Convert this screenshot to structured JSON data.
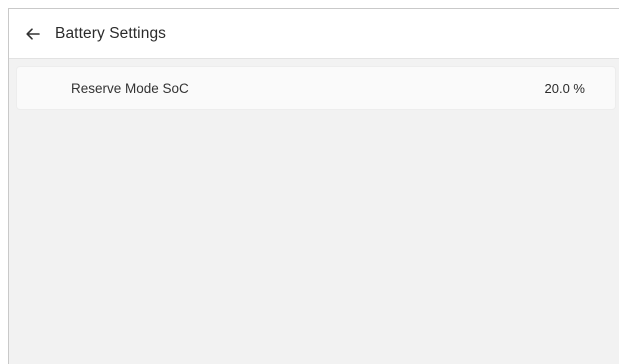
{
  "header": {
    "back_icon": "arrow-left-icon",
    "title": "Battery Settings"
  },
  "settings": {
    "items": [
      {
        "label": "Reserve Mode SoC",
        "value": "20.0 %"
      }
    ]
  },
  "colors": {
    "background": "#f2f2f2",
    "header_bg": "#ffffff",
    "row_bg": "#fafafa",
    "text": "#2b2b2b"
  }
}
